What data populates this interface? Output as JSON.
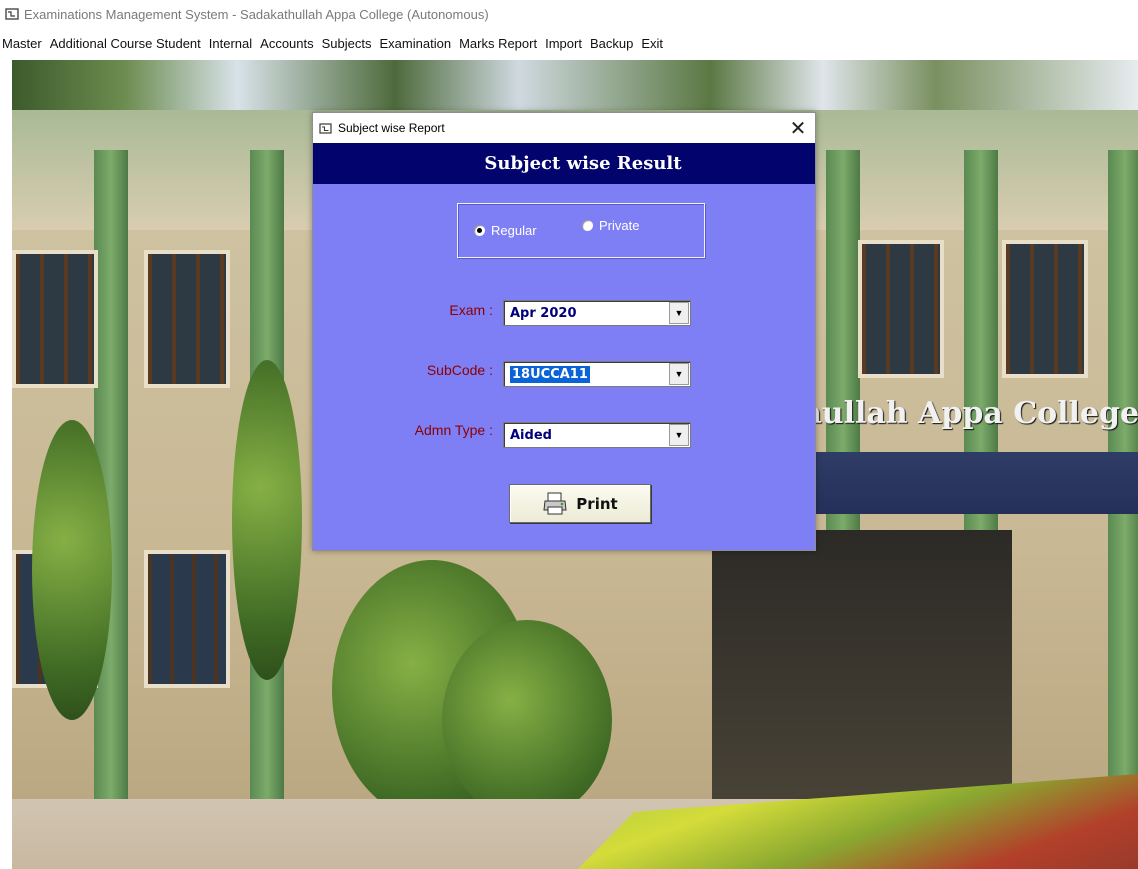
{
  "window": {
    "title": "Examinations Management System - Sadakathullah Appa College (Autonomous)",
    "icon": "app-icon"
  },
  "menu": [
    {
      "label": "Master"
    },
    {
      "label": "Additional Course Student"
    },
    {
      "label": "Internal"
    },
    {
      "label": "Accounts"
    },
    {
      "label": "Subjects"
    },
    {
      "label": "Examination"
    },
    {
      "label": "Marks Report"
    },
    {
      "label": "Import"
    },
    {
      "label": "Backup"
    },
    {
      "label": "Exit"
    }
  ],
  "background": {
    "college_name": "hullah Appa College"
  },
  "dialog": {
    "title": "Subject wise Report",
    "close": "✕",
    "header": "Subject wise Result",
    "student_type": {
      "options": [
        {
          "label": "Regular",
          "checked": true
        },
        {
          "label": "Private",
          "checked": false
        }
      ]
    },
    "fields": {
      "exam": {
        "label": "Exam :",
        "value": "Apr 2020"
      },
      "subcode": {
        "label": "SubCode :",
        "value": "18UCCA11"
      },
      "admn_type": {
        "label": "Admn Type :",
        "value": "Aided"
      }
    },
    "print_label": "Print"
  },
  "colors": {
    "dialog_bg": "#7f7ff5",
    "header_bg": "#03036e",
    "label_color": "#8a0000",
    "combo_text": "#00007a"
  }
}
